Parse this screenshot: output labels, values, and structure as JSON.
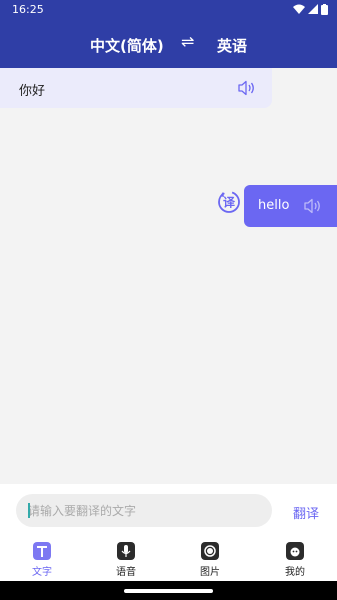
{
  "status": {
    "time": "16:25"
  },
  "header": {
    "source_lang": "中文(简体)",
    "swap_symbol": "⇌",
    "target_lang": "英语"
  },
  "messages": {
    "source_text": "你好",
    "translated_text": "hello",
    "badge_char": "译"
  },
  "input": {
    "placeholder": "请输入要翻译的文字",
    "value": "",
    "translate_label": "翻译"
  },
  "tabs": [
    {
      "label": "文字",
      "icon": "text-icon",
      "active": true
    },
    {
      "label": "语音",
      "icon": "microphone-icon",
      "active": false
    },
    {
      "label": "图片",
      "icon": "camera-icon",
      "active": false
    },
    {
      "label": "我的",
      "icon": "profile-icon",
      "active": false
    }
  ],
  "colors": {
    "header": "#2f3ea6",
    "accent": "#6b67f2",
    "bubble_light": "#ebebfb"
  }
}
